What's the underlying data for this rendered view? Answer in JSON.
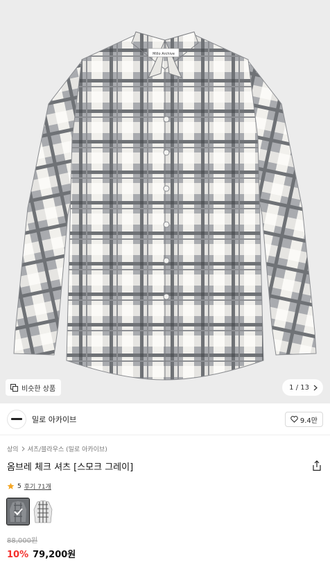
{
  "hero": {
    "similar_label": "비슷한 상품",
    "counter": "1 / 13",
    "shirt_tag": "Millo Archive"
  },
  "brand": {
    "name": "밀로 아카이브",
    "likes": "9.4만"
  },
  "breadcrumb": {
    "level1": "상의",
    "level2": "셔츠/블라우스 (밀로 아카이브)"
  },
  "product": {
    "title": "옴브레 체크 셔츠 [스모크 그레이]",
    "rating": "5",
    "reviews": "후기 71개",
    "original_price": "88,000원",
    "discount": "10%",
    "price": "79,200원"
  },
  "colors": {
    "accent_red": "#f4302c",
    "star": "#f5a623"
  }
}
